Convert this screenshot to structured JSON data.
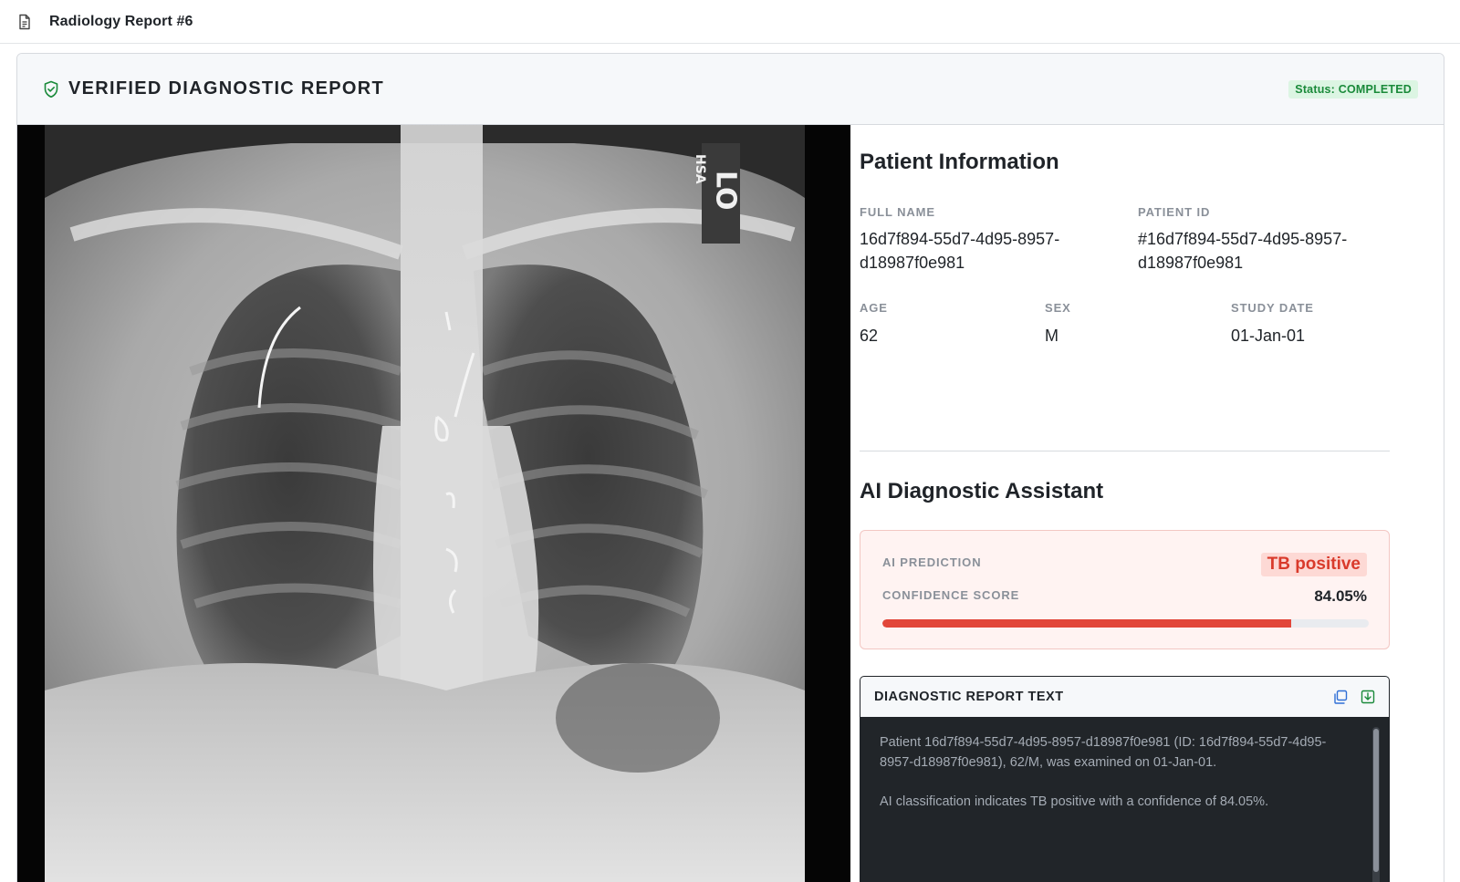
{
  "window": {
    "title": "Radiology Report #6"
  },
  "header": {
    "heading": "VERIFIED DIAGNOSTIC REPORT",
    "status": "Status: COMPLETED"
  },
  "xray": {
    "marker_letters": "HSA",
    "side_marker": "LO"
  },
  "patient": {
    "section_title": "Patient Information",
    "full_name_label": "FULL NAME",
    "full_name": "16d7f894-55d7-4d95-8957-d18987f0e981",
    "patient_id_label": "PATIENT ID",
    "patient_id": "#16d7f894-55d7-4d95-8957-d18987f0e981",
    "age_label": "AGE",
    "age": "62",
    "sex_label": "SEX",
    "sex": "M",
    "study_date_label": "STUDY DATE",
    "study_date": "01-Jan-01"
  },
  "ai": {
    "section_title": "AI Diagnostic Assistant",
    "prediction_label": "AI PREDICTION",
    "prediction": "TB positive",
    "confidence_label": "CONFIDENCE SCORE",
    "confidence_text": "84.05%",
    "confidence_fraction": 0.8405
  },
  "report": {
    "title": "DIAGNOSTIC REPORT TEXT",
    "copy_icon": "copy-icon",
    "download_icon": "download-icon",
    "paragraphs": [
      "Patient 16d7f894-55d7-4d95-8957-d18987f0e981 (ID: 16d7f894-55d7-4d95-8957-d18987f0e981), 62/M, was examined on 01-Jan-01.",
      "AI classification indicates TB positive with a confidence of 84.05%."
    ]
  },
  "colors": {
    "status_green": "#1a8a3a",
    "prediction_red": "#d93a2b",
    "bar_red": "#e2463a",
    "icon_blue": "#2f6fd6"
  }
}
